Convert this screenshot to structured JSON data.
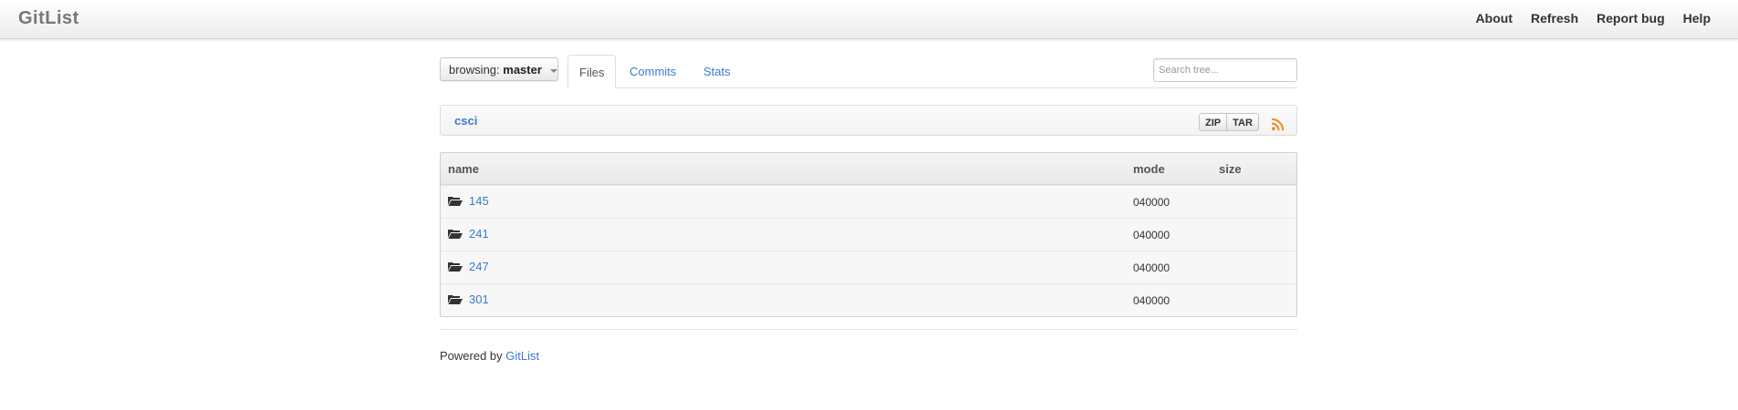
{
  "navbar": {
    "brand": "GitList",
    "links": [
      "About",
      "Refresh",
      "Report bug",
      "Help"
    ]
  },
  "branch": {
    "prefix": "browsing:",
    "name": "master"
  },
  "tabs": [
    {
      "label": "Files",
      "active": true
    },
    {
      "label": "Commits",
      "active": false
    },
    {
      "label": "Stats",
      "active": false
    }
  ],
  "search": {
    "placeholder": "Search tree..."
  },
  "breadcrumb": {
    "path": "csci"
  },
  "downloads": {
    "zip": "ZIP",
    "tar": "TAR"
  },
  "table": {
    "headers": {
      "name": "name",
      "mode": "mode",
      "size": "size"
    },
    "rows": [
      {
        "name": "145",
        "mode": "040000",
        "size": "",
        "icon": "folder-icon"
      },
      {
        "name": "241",
        "mode": "040000",
        "size": "",
        "icon": "folder-icon"
      },
      {
        "name": "247",
        "mode": "040000",
        "size": "",
        "icon": "folder-icon"
      },
      {
        "name": "301",
        "mode": "040000",
        "size": "",
        "icon": "folder-icon"
      }
    ]
  },
  "footer": {
    "prefix": "Powered by",
    "link": "GitList"
  },
  "colors": {
    "link": "#3a7bc8",
    "rss": "#f08a24",
    "brand": "#777777"
  }
}
